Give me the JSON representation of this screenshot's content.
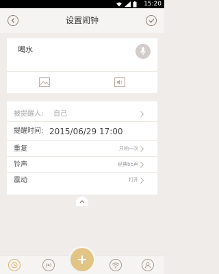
{
  "status_bar": {
    "time": "15:20"
  },
  "header": {
    "title": "设置闹钟"
  },
  "reminder": {
    "content": "喝水"
  },
  "settings": {
    "recipient": {
      "label": "被提醒人:",
      "value": "自己"
    },
    "time": {
      "label": "提醒时间:",
      "value": "2015/06/29  17:00"
    },
    "repeat": {
      "label": "重复",
      "value": "只响一次"
    },
    "ringtone": {
      "label": "铃声",
      "value": "经典bb声"
    },
    "vibrate": {
      "label": "震动",
      "value": "打开"
    }
  },
  "icons": {
    "back": "back-icon",
    "confirm": "check-icon",
    "mic": "microphone-icon",
    "image": "image-icon",
    "audio": "audio-icon",
    "collapse": "chevron-up-icon",
    "tabs": [
      "alarm-clock-icon",
      "broadcast-icon",
      "add-icon",
      "wifi-icon",
      "profile-icon"
    ]
  },
  "colors": {
    "accent": "#e2c585",
    "background": "#efecea",
    "card": "#ffffff"
  }
}
